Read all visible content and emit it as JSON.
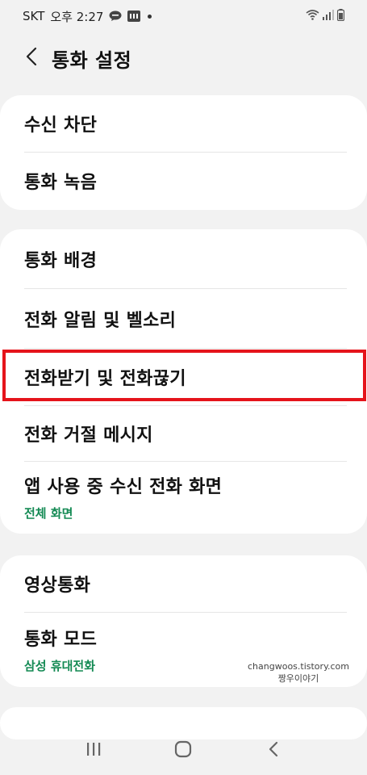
{
  "status_bar": {
    "carrier": "SKT",
    "time": "오후 2:27"
  },
  "header": {
    "title": "통화 설정"
  },
  "sections": [
    {
      "items": [
        {
          "label": "수신 차단"
        },
        {
          "label": "통화 녹음"
        }
      ]
    },
    {
      "items": [
        {
          "label": "통화 배경"
        },
        {
          "label": "전화 알림 및 벨소리"
        },
        {
          "label": "전화받기 및 전화끊기"
        },
        {
          "label": "전화 거절 메시지"
        },
        {
          "label": "앱 사용 중 수신 전화 화면",
          "sub": "전체 화면"
        }
      ]
    },
    {
      "items": [
        {
          "label": "영상통화"
        },
        {
          "label": "통화 모드",
          "sub": "삼성 휴대전화"
        }
      ]
    }
  ],
  "watermark": {
    "line1": "changwoos.tistory.com",
    "line2": "짱우이야기"
  },
  "colors": {
    "accent_green": "#148a54",
    "highlight_red": "#e5141b",
    "background": "#f2f2f2"
  }
}
